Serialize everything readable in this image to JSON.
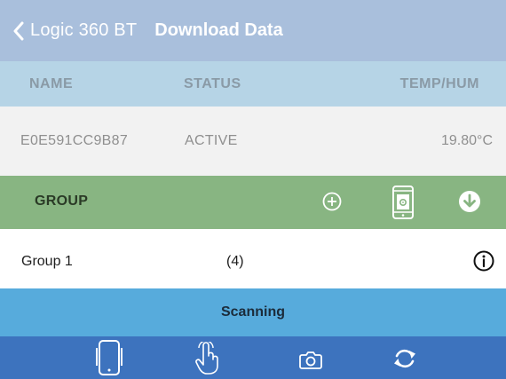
{
  "nav": {
    "back_label": "Logic 360 BT",
    "title": "Download Data"
  },
  "columns": {
    "name": "NAME",
    "status": "STATUS",
    "temp_hum": "TEMP/HUM"
  },
  "device": {
    "name": "E0E591CC9B87",
    "status": "ACTIVE",
    "temp": "19.80°C"
  },
  "group_header": {
    "label": "GROUP",
    "icons": [
      "add-circle-icon",
      "phone-download-icon",
      "download-circle-icon"
    ]
  },
  "groups": [
    {
      "name": "Group 1",
      "count": "(4)"
    }
  ],
  "status_bar": {
    "label": "Scanning"
  },
  "tab_bar": {
    "icons": [
      "device-icon",
      "touch-icon",
      "camera-icon",
      "refresh-icon"
    ]
  },
  "colors": {
    "nav_bg": "#a9bfdc",
    "header_bg": "#b6d4e6",
    "group_bg": "#88b582",
    "scan_bg": "#57abdc",
    "tab_bg": "#3d73be"
  }
}
